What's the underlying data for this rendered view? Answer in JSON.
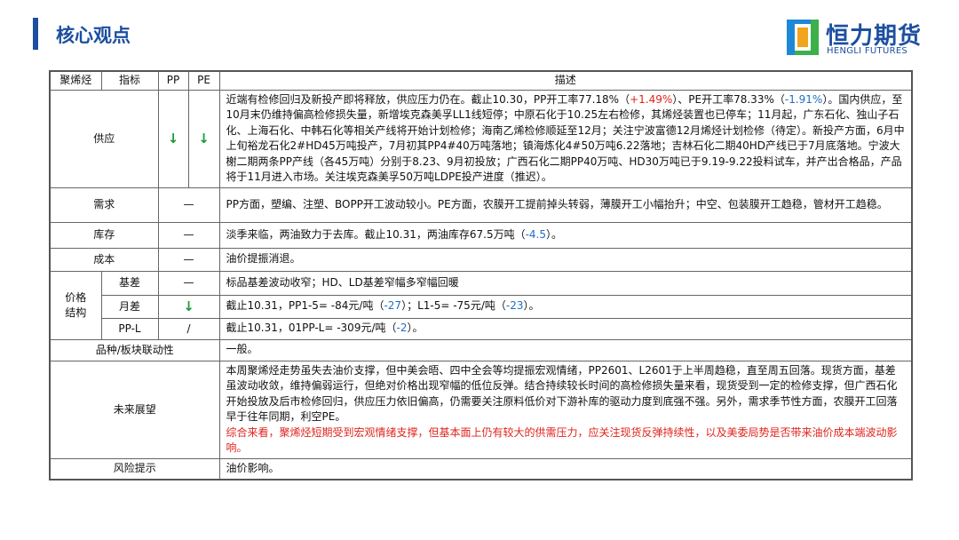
{
  "header": {
    "title": "核心观点",
    "logo_cn": "恒力期货",
    "logo_en": "HENGLI FUTURES"
  },
  "table": {
    "headers": [
      "聚烯烃",
      "指标",
      "PP",
      "PE",
      "描述"
    ],
    "supply": {
      "label": "供应",
      "pp": "↓",
      "pe": "↓",
      "desc_a": "近端有检修回归及新投产即将释放，供应压力仍在。截止10.30，PP开工率77.18%（",
      "pp_change": "+1.49%",
      "desc_b": "）、PE开工率78.33%（",
      "pe_change": "-1.91%",
      "desc_c": "）。国内供应，至10月末仍维持偏高检修损失量，新增埃克森美孚LL1线短停；中原石化于10.25左右检修，其烯烃装置也已停车；11月起，广东石化、独山子石化、上海石化、中韩石化等相关产线将开始计划检修；海南乙烯检修顺延至12月；关注宁波富德12月烯烃计划检修（待定）。新投产方面，6月中上旬裕龙石化2#HD45万吨投产，7月初其PP4#40万吨落地；镇海炼化4#50万吨6.22落地；吉林石化二期40HD产线已于7月底落地。宁波大榭二期两条PP产线（各45万吨）分别于8.23、9月初投放；广西石化二期PP40万吨、HD30万吨已于9.19-9.22投料试车，并产出合格品，产品将于11月进入市场。关注埃克森美孚50万吨LDPE投产进度（推迟）。"
    },
    "demand": {
      "label": "需求",
      "ind": "—",
      "desc": "PP方面，塑编、注塑、BOPP开工波动较小。PE方面，农膜开工提前掉头转弱，薄膜开工小幅抬升；中空、包装膜开工趋稳，管材开工趋稳。"
    },
    "inventory": {
      "label": "库存",
      "ind": "—",
      "desc_a": "淡季来临，两油致力于去库。截止10.31，两油库存67.5万吨（",
      "change": "-4.5",
      "desc_b": "）。"
    },
    "cost": {
      "label": "成本",
      "ind": "—",
      "desc": "油价提振消退。"
    },
    "price": {
      "label": "价格结构",
      "basis": {
        "label": "基差",
        "ind": "—",
        "desc": "标品基差波动收窄；HD、LD基差窄幅多窄幅回暖"
      },
      "month": {
        "label": "月差",
        "ind": "↓",
        "desc_a": "截止10.31，PP1-5= -84元/吨（",
        "pp_change": "-27",
        "desc_b": "）；L1-5= -75元/吨（",
        "l_change": "-23",
        "desc_c": "）。"
      },
      "ppl": {
        "label": "PP-L",
        "ind": "/",
        "desc_a": "截止10.31，01PP-L= -309元/吨（",
        "change": "-2",
        "desc_b": "）。"
      }
    },
    "linkage": {
      "label": "品种/板块联动性",
      "desc": "一般。"
    },
    "outlook": {
      "label": "未来展望",
      "desc": "本周聚烯烃走势虽失去油价支撑，但中美会晤、四中全会等均提振宏观情绪，PP2601、L2601于上半周趋稳，直至周五回落。现货方面，基差虽波动收敛，维持偏弱运行，但绝对价格出现窄幅的低位反弹。结合持续较长时间的高检修损失量来看，现货受到一定的检修支撑，但广西石化开始投放及后市检修回归，供应压力依旧偏高，仍需要关注原料低价对下游补库的驱动力度到底强不强。另外，需求季节性方面，农膜开工回落早于往年同期，利空PE。",
      "conclusion": "综合来看，聚烯烃短期受到宏观情绪支撑，但基本面上仍有较大的供需压力，应关注现货反弹持续性，以及美委局势是否带来油价成本端波动影响。"
    },
    "risk": {
      "label": "风险提示",
      "desc": "油价影响。"
    }
  }
}
